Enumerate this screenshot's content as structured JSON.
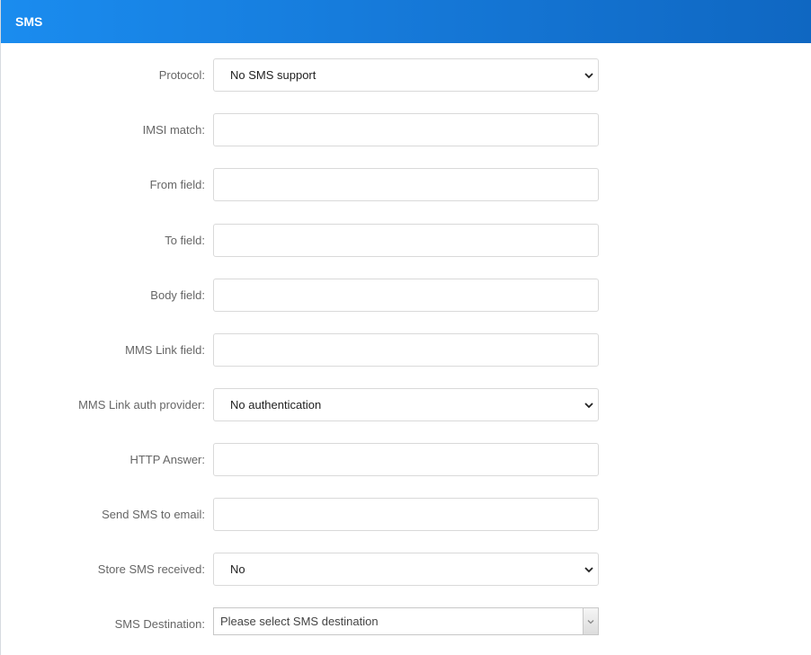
{
  "header": {
    "title": "SMS"
  },
  "form": {
    "protocol": {
      "label": "Protocol:",
      "value": "No SMS support"
    },
    "imsi_match": {
      "label": "IMSI match:",
      "value": ""
    },
    "from_field": {
      "label": "From field:",
      "value": ""
    },
    "to_field": {
      "label": "To field:",
      "value": ""
    },
    "body_field": {
      "label": "Body field:",
      "value": ""
    },
    "mms_link_field": {
      "label": "MMS Link field:",
      "value": ""
    },
    "mms_link_auth_provider": {
      "label": "MMS Link auth provider:",
      "value": "No authentication"
    },
    "http_answer": {
      "label": "HTTP Answer:",
      "value": ""
    },
    "send_sms_to_email": {
      "label": "Send SMS to email:",
      "value": ""
    },
    "store_sms_received": {
      "label": "Store SMS received:",
      "value": "No"
    },
    "sms_destination": {
      "label": "SMS Destination:",
      "placeholder": "Please select SMS destination"
    }
  },
  "icons": {
    "select_arrow": "chevron-down-icon",
    "dropdown_arrow": "caret-down-icon"
  }
}
